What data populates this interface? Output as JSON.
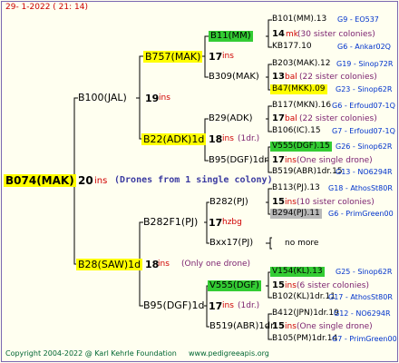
{
  "header": {
    "date": "29-  1-2022 ( 21: 14)"
  },
  "root": {
    "name": "B074(MAK)",
    "num": "20",
    "ins": "ins",
    "drones": "(Drones from 1 single colony)"
  },
  "l1": [
    {
      "name": "B100(JAL)",
      "num": "19",
      "ins": "ins"
    },
    {
      "name": "B28(SAW)1d",
      "num": "18",
      "ins": "ins",
      "note": "(Only one drone)"
    }
  ],
  "l2": [
    {
      "name": "B757(MAK)",
      "num": "17",
      "ins": "ins"
    },
    {
      "name": "B22(ADK)1d",
      "num": "18",
      "ins": "ins",
      "note": "(1dr.)"
    },
    {
      "name": "B282F1(PJ)",
      "num": "17",
      "ins": "hzbg"
    },
    {
      "name": "B95(DGF)1d",
      "num": "17",
      "ins": "ins",
      "note": "(1dr.)"
    }
  ],
  "l3": [
    {
      "name": "B11(MM)",
      "num": "14",
      "ins": "mk",
      "sub": "(30 sister colonies)"
    },
    {
      "name": "B309(MAK)",
      "num": "13",
      "ins": "bal",
      "sub": "(22 sister colonies)"
    },
    {
      "name": "B29(ADK)",
      "num": "17",
      "ins": "bal",
      "sub": "(22 sister colonies)"
    },
    {
      "name": "B95(DGF)1dr",
      "num": "17",
      "ins": "ins",
      "sub": "(One single drone)"
    },
    {
      "name": "B282(PJ)",
      "num": "15",
      "ins": "ins",
      "sub": "(10 sister colonies)"
    },
    {
      "name": "Bxx17(PJ)",
      "more": "no more"
    },
    {
      "name": "V555(DGF)",
      "num": "15",
      "ins": "ins",
      "sub": "(6 sister colonies)"
    },
    {
      "name": "B519(ABR)1dr",
      "num": "15",
      "ins": "ins",
      "sub": "(One single drone)"
    }
  ],
  "l4": [
    {
      "name": "B101(MM).13",
      "tag": "G9 - EO537"
    },
    {
      "name": "KB177.10",
      "tag": "G6 - Ankar02Q"
    },
    {
      "name": "B203(MAK).12",
      "tag": "G19 - Sinop72R"
    },
    {
      "name": "B47(MKK).09",
      "tag": "G23 - Sinop62R"
    },
    {
      "name": "B117(MKN).16",
      "tag": "G6 - Erfoud07-1Q"
    },
    {
      "name": "B106(IC).15",
      "tag": "G7 - Erfoud07-1Q"
    },
    {
      "name": "V555(DGF).15",
      "tag": "G26 - Sinop62R"
    },
    {
      "name": "B519(ABR)1dr.15",
      "tag": "G13 - NO6294R"
    },
    {
      "name": "B113(PJ).13",
      "tag": "G18 - AthosSt80R"
    },
    {
      "name": "B294(PJ).11",
      "tag": "G6 - PrimGreen00"
    },
    {
      "name": "V154(KL).13",
      "tag": "G25 - Sinop62R"
    },
    {
      "name": "B102(KL)1dr.11",
      "tag": "G17 - AthosSt80R"
    },
    {
      "name": "B412(JPN)1dr.19",
      "tag": "G12 - NO6294R"
    },
    {
      "name": "B105(PM)1dr.14",
      "tag": "G7 - PrimGreen00"
    }
  ],
  "footer": {
    "copyright": "Copyright 2004-2022 @ Karl Kehrle Foundation",
    "url": "www.pedigreeapis.org"
  }
}
